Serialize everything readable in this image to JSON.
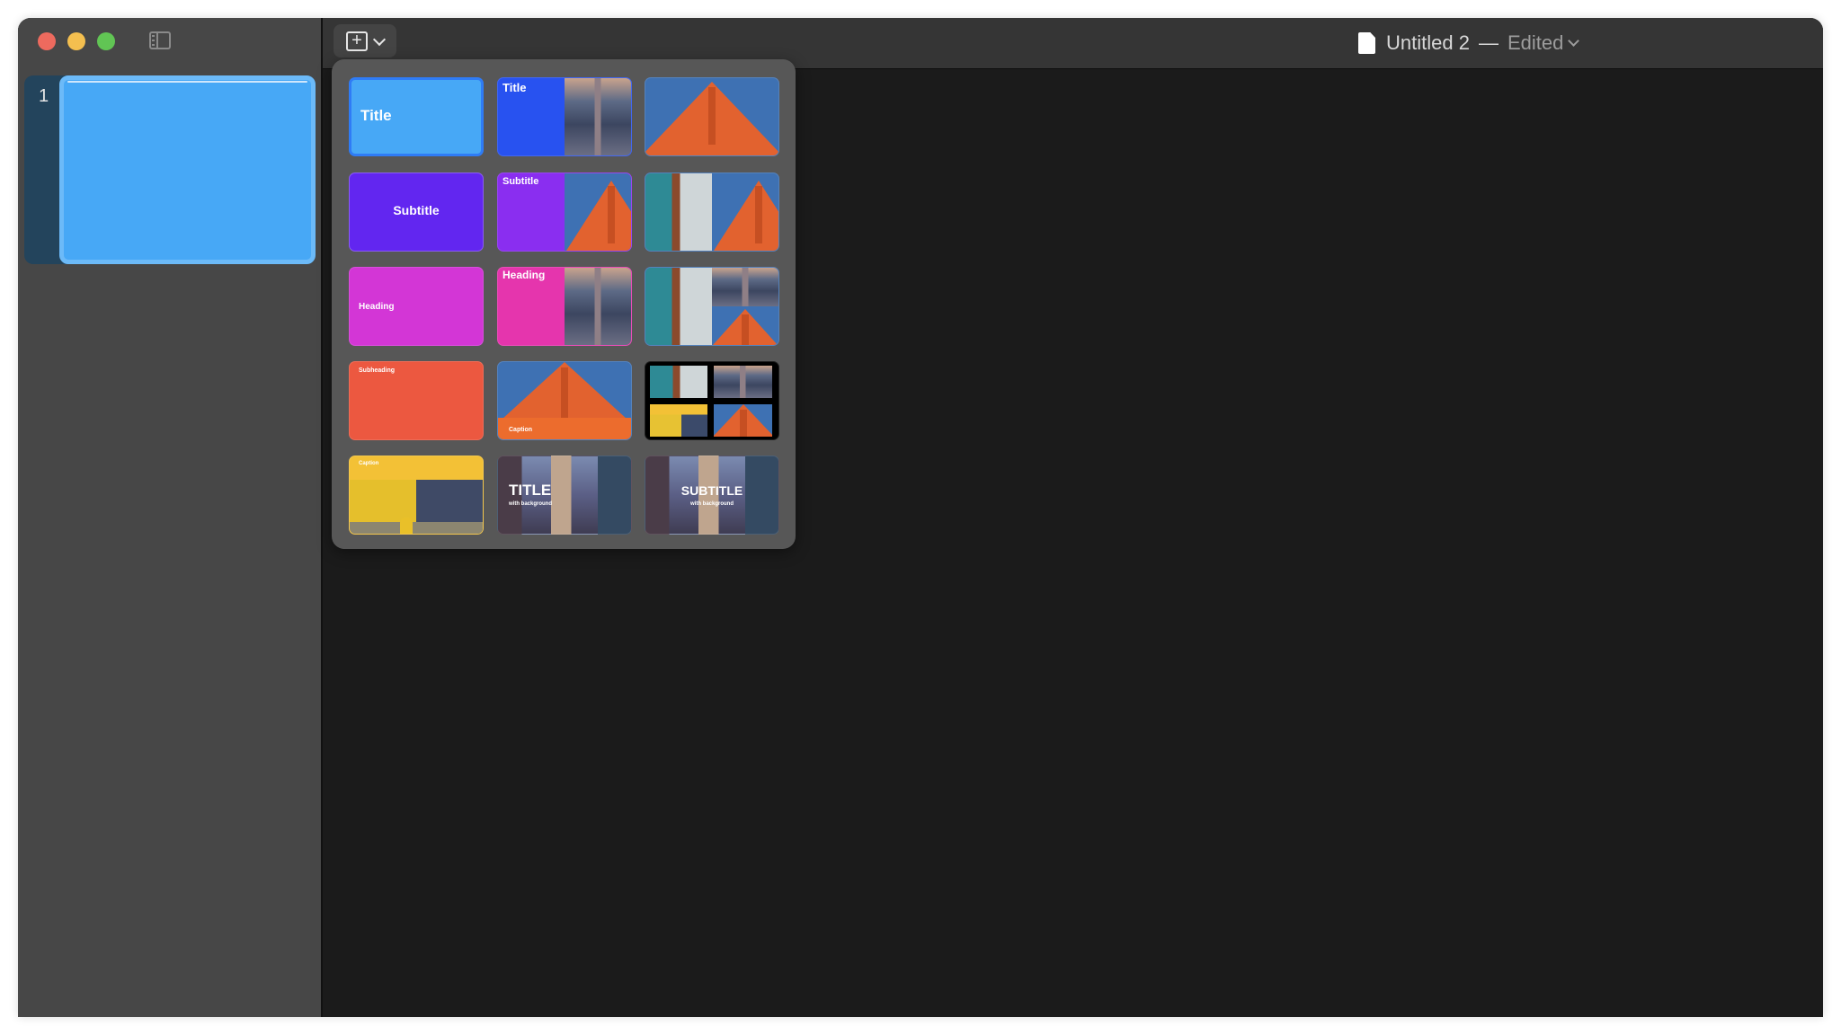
{
  "window": {
    "title": "Untitled 2",
    "title_separator": "—",
    "status": "Edited"
  },
  "toolbar": {
    "add_slide_icon": "plus-square-icon",
    "add_slide_menu_icon": "chevron-down-icon",
    "plus_glyph": "+"
  },
  "sidebar": {
    "toggle_icon": "sidebar-icon",
    "slides": [
      {
        "number": "1",
        "background_color": "#47a8f6",
        "selected": true
      }
    ]
  },
  "template_picker": {
    "templates": [
      {
        "label": "Title",
        "style": "solid",
        "color": "#47a8f6",
        "selected": true
      },
      {
        "label": "Title",
        "style": "split-photo",
        "color": "#2852f0",
        "photo": "street"
      },
      {
        "label": "",
        "style": "photo",
        "photo": "bridge-tower"
      },
      {
        "label": "Subtitle",
        "style": "solid",
        "color": "#6226f0"
      },
      {
        "label": "Subtitle",
        "style": "split-photo",
        "color": "#8a2ef0",
        "photo": "bridge-tower"
      },
      {
        "label": "",
        "style": "two-photos",
        "photo": "aerial-bridge + bridge-tower"
      },
      {
        "label": "Heading",
        "style": "solid",
        "color": "#d336d6"
      },
      {
        "label": "Heading",
        "style": "split-photo",
        "color": "#e535ad",
        "photo": "street"
      },
      {
        "label": "",
        "style": "three-photos",
        "photo": "aerial-bridge + street + bridge-tower"
      },
      {
        "label": "Subheading",
        "style": "solid",
        "color": "#ec5840"
      },
      {
        "label": "Caption",
        "style": "photo-caption",
        "color": "#ec6c2d",
        "photo": "bridge-tower"
      },
      {
        "label": "",
        "style": "four-photos",
        "photo": "aerial-bridge + street + yellow-house + bridge-tower"
      },
      {
        "label": "Caption",
        "style": "caption-photo",
        "color": "#f3c136",
        "photo": "yellow-house"
      },
      {
        "label": "TITLE",
        "sublabel": "with background",
        "style": "photo-background",
        "photo": "street"
      },
      {
        "label": "SUBTITLE",
        "sublabel": "with background",
        "style": "photo-background",
        "photo": "street"
      }
    ]
  }
}
